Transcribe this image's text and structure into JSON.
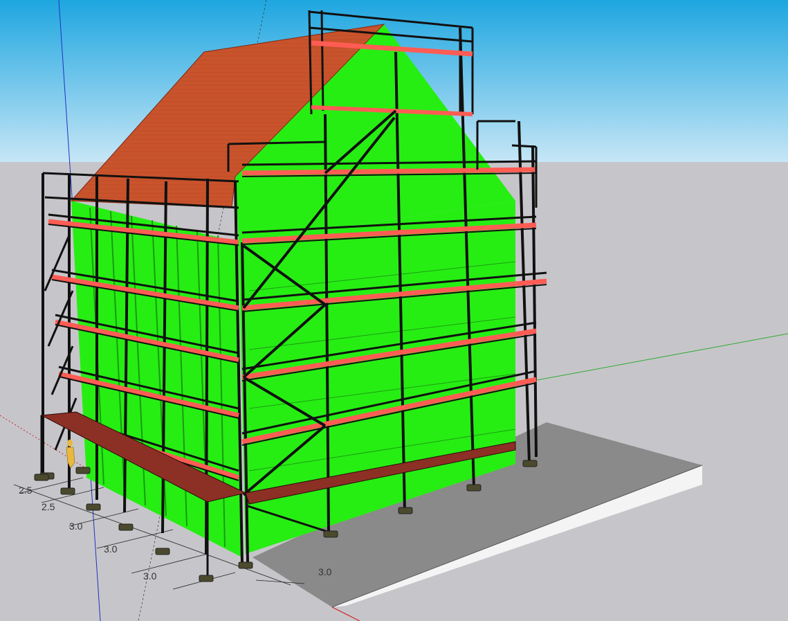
{
  "scene": {
    "colors": {
      "sky_top": "#1ea6e0",
      "sky_bottom": "#c4e4f4",
      "ground": "#c6c6ca",
      "facade": "#26ee13",
      "roof": "#c9532b",
      "plank_red": "#ff5c54",
      "plank_brown": "#8c2f25",
      "frame": "#111111",
      "slab_top": "#8a8a8a",
      "slab_side": "#f4f4f4",
      "axis_green": "#2eaa2e",
      "axis_red": "#d02020",
      "axis_blue": "#2030c0"
    },
    "dimension_labels": [
      "2.5",
      "2.5",
      "3.0",
      "3.0",
      "3.0",
      "3.0"
    ],
    "objects": {
      "building": "building-model",
      "scaffold": "scaffold-system",
      "figure": "person-scale-figure"
    }
  }
}
